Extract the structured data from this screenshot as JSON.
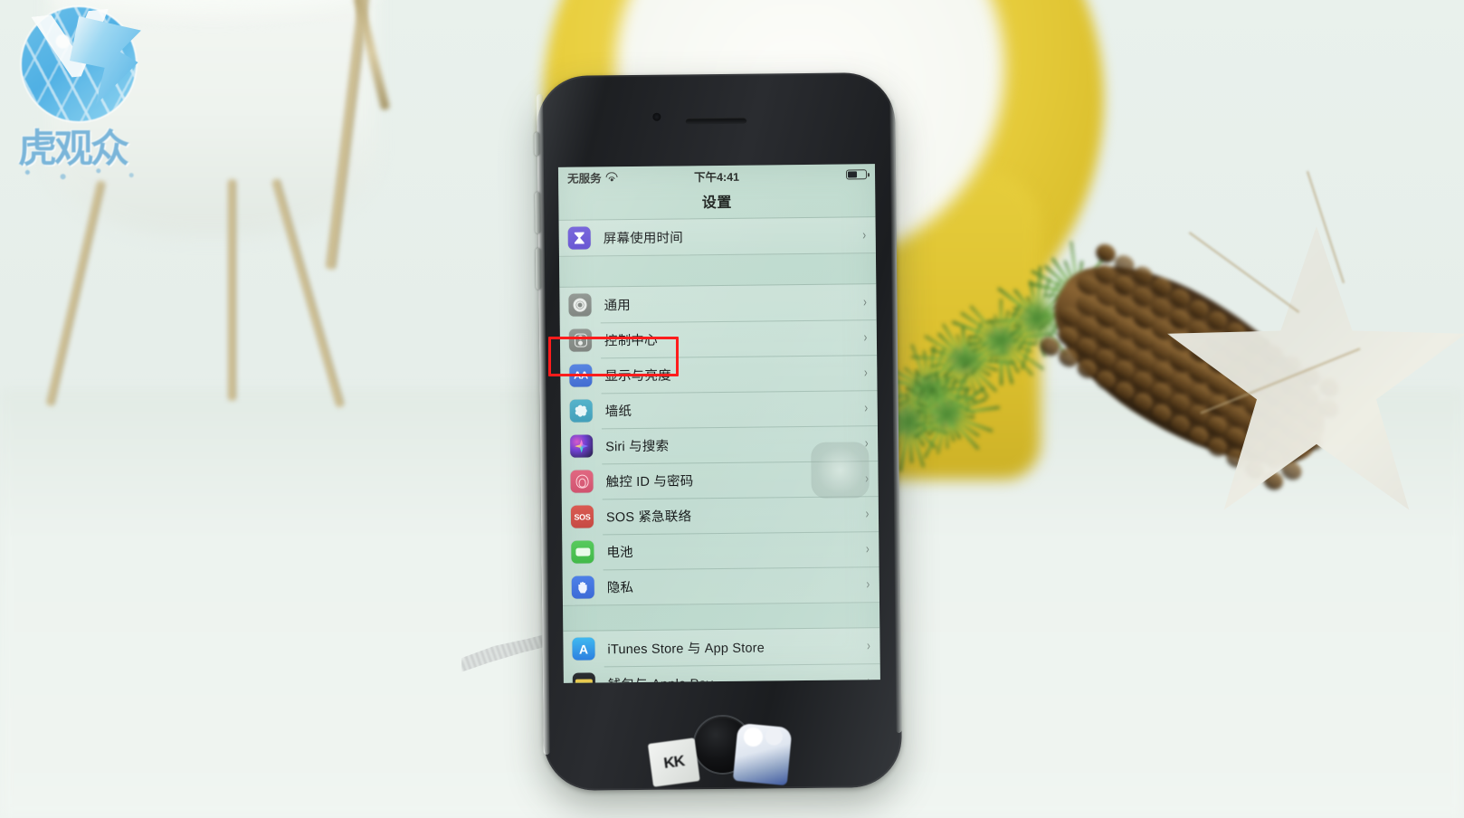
{
  "scene": {
    "description": "iPhone on a table showing the Chinese iOS Settings app, with a red highlight box around Display & Brightness"
  },
  "watermark": {
    "logo_name": "globe-v-logo",
    "text": "虎观众",
    "color": "#2fa3e3"
  },
  "phone": {
    "home_button_name": "home-button",
    "earpiece_name": "earpiece-speaker",
    "stickers": {
      "left_label": "KK",
      "right_name": "bear-charm-sticker"
    }
  },
  "statusbar": {
    "carrier": "无服务",
    "wifi_icon": "wifi-icon",
    "time": "下午4:41",
    "battery_icon": "battery-icon",
    "battery_level": 52
  },
  "nav": {
    "title": "设置"
  },
  "highlight": {
    "color": "#ff1c1c",
    "target": "显示与亮度"
  },
  "settings_groups": [
    {
      "id": "group-screentime",
      "rows": [
        {
          "label": "屏幕使用时间",
          "icon": "screen-time-icon",
          "icon_class": "ic-screentime",
          "chevron": "›"
        }
      ]
    },
    {
      "id": "group-system",
      "rows": [
        {
          "label": "通用",
          "icon": "gear-icon",
          "icon_class": "ic-general",
          "chevron": "›"
        },
        {
          "label": "控制中心",
          "icon": "control-center-icon",
          "icon_class": "ic-control",
          "chevron": "›"
        },
        {
          "label": "显示与亮度",
          "icon": "display-brightness-icon",
          "icon_class": "ic-display",
          "icon_text": "AA",
          "chevron": "›"
        },
        {
          "label": "墙纸",
          "icon": "wallpaper-icon",
          "icon_class": "ic-wallpaper",
          "chevron": "›"
        },
        {
          "label": "Siri 与搜索",
          "icon": "siri-icon",
          "icon_class": "ic-siri",
          "chevron": "›"
        },
        {
          "label": "触控 ID 与密码",
          "icon": "touch-id-icon",
          "icon_class": "ic-touchid",
          "chevron": "›"
        },
        {
          "label": "SOS 紧急联络",
          "icon": "sos-icon",
          "icon_class": "ic-sos",
          "icon_text": "SOS",
          "chevron": "›"
        },
        {
          "label": "电池",
          "icon": "battery-settings-icon",
          "icon_class": "ic-battery",
          "chevron": "›"
        },
        {
          "label": "隐私",
          "icon": "privacy-hand-icon",
          "icon_class": "ic-privacy",
          "chevron": "›"
        }
      ]
    },
    {
      "id": "group-store",
      "rows": [
        {
          "label": "iTunes Store 与 App Store",
          "icon": "app-store-icon",
          "icon_class": "ic-appstore",
          "chevron": "›"
        },
        {
          "label": "钱包与 Apple Pay",
          "icon": "wallet-icon",
          "icon_class": "ic-wallet",
          "chevron": "›"
        }
      ]
    }
  ],
  "background_objects": [
    {
      "name": "white-planter",
      "color": "#f0f4ef"
    },
    {
      "name": "yellow-vase",
      "color": "#e3c835"
    },
    {
      "name": "pine-branch",
      "color": "#5d9b3c"
    },
    {
      "name": "pine-cone",
      "color": "#6b4c26"
    },
    {
      "name": "glitter-star",
      "color": "#eceadf"
    }
  ]
}
